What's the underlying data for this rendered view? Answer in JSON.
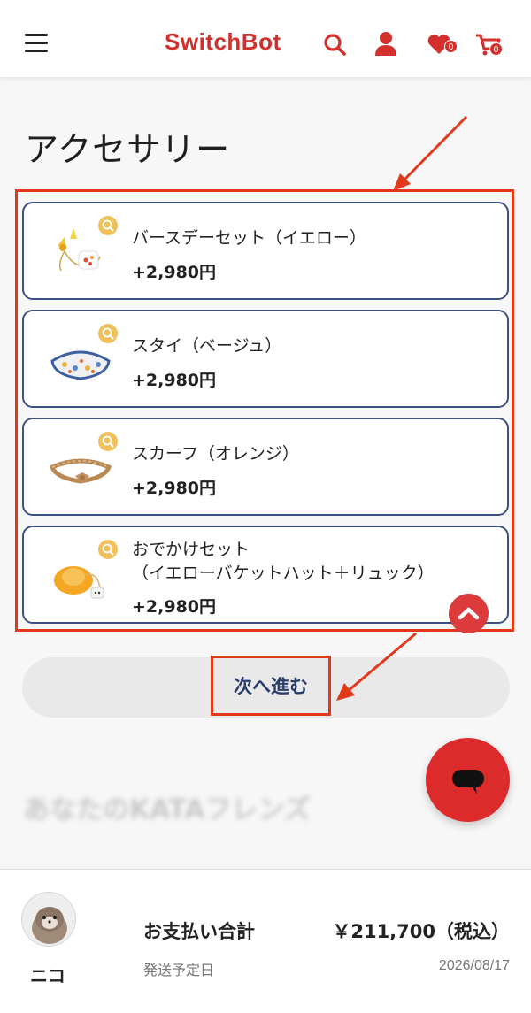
{
  "header": {
    "logo": "SwitchBot",
    "favorites_count": "0",
    "cart_count": "0"
  },
  "page": {
    "title": "アクセサリー"
  },
  "accessories": [
    {
      "name": "バースデーセット（イエロー）",
      "price": "+2,980円"
    },
    {
      "name": "スタイ（ベージュ）",
      "price": "+2,980円"
    },
    {
      "name": "スカーフ（オレンジ）",
      "price": "+2,980円"
    },
    {
      "name": "おでかけセット\n（イエローバケットハット＋リュック）",
      "price": "+2,980円"
    }
  ],
  "next_button": {
    "label": "次へ進む"
  },
  "blurred_section": {
    "heading": "あなたのKATAフレンズ"
  },
  "footer": {
    "avatar_name": "ニコ",
    "total_label": "お支払い合計",
    "total_value": "￥211,700（税込）",
    "ship_label": "発送予定日",
    "ship_value": "2026/08/17"
  },
  "colors": {
    "brand_red": "#d1302c",
    "card_border": "#3d5080",
    "annotation_red": "#e2381c",
    "zoom_badge": "#f0c15a"
  },
  "icons": [
    "hamburger-menu-icon",
    "search-icon",
    "user-icon",
    "heart-icon",
    "cart-icon",
    "zoom-icon",
    "chevron-up-icon",
    "chat-icon"
  ]
}
